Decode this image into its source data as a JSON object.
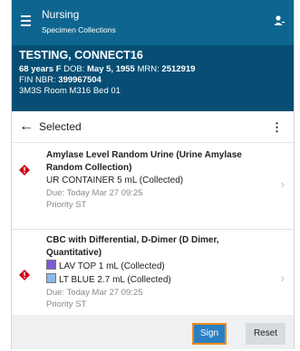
{
  "header": {
    "title": "Nursing",
    "subtitle": "Specimen Collections"
  },
  "patient": {
    "name": "TESTING, CONNECT16",
    "age": "68 years",
    "sex": "F",
    "dob_label": "DOB:",
    "dob": "May 5, 1955",
    "mrn_label": "MRN:",
    "mrn": "2512919",
    "fin_label": "FIN NBR:",
    "fin": "399967504",
    "location": "3M3S Room M316 Bed 01"
  },
  "selected_bar": {
    "title": "Selected"
  },
  "orders": [
    {
      "name": "Amylase Level Random Urine (Urine Amylase Random Collection)",
      "containers": [
        {
          "label": "UR CONTAINER 5 mL (Collected)",
          "color": ""
        }
      ],
      "due": "Due: Today Mar 27 09:25",
      "priority": "Priority  ST"
    },
    {
      "name": "CBC with Differential, D-Dimer (D Dimer, Quantitative)",
      "containers": [
        {
          "label": "LAV TOP 1 mL (Collected)",
          "color": "#7b5bd6"
        },
        {
          "label": "LT BLUE 2.7 mL (Collected)",
          "color": "#8bb8e8"
        }
      ],
      "due": "Due: Today Mar 27 09:25",
      "priority": "Priority  ST"
    }
  ],
  "footer": {
    "sign": "Sign",
    "reset": "Reset"
  },
  "colors": {
    "header_bg": "#0e6690",
    "banner_bg": "#074e74",
    "alert": "#d0021b",
    "sign_btn": "#2b7fc3",
    "sign_outline": "#f08a1c"
  }
}
